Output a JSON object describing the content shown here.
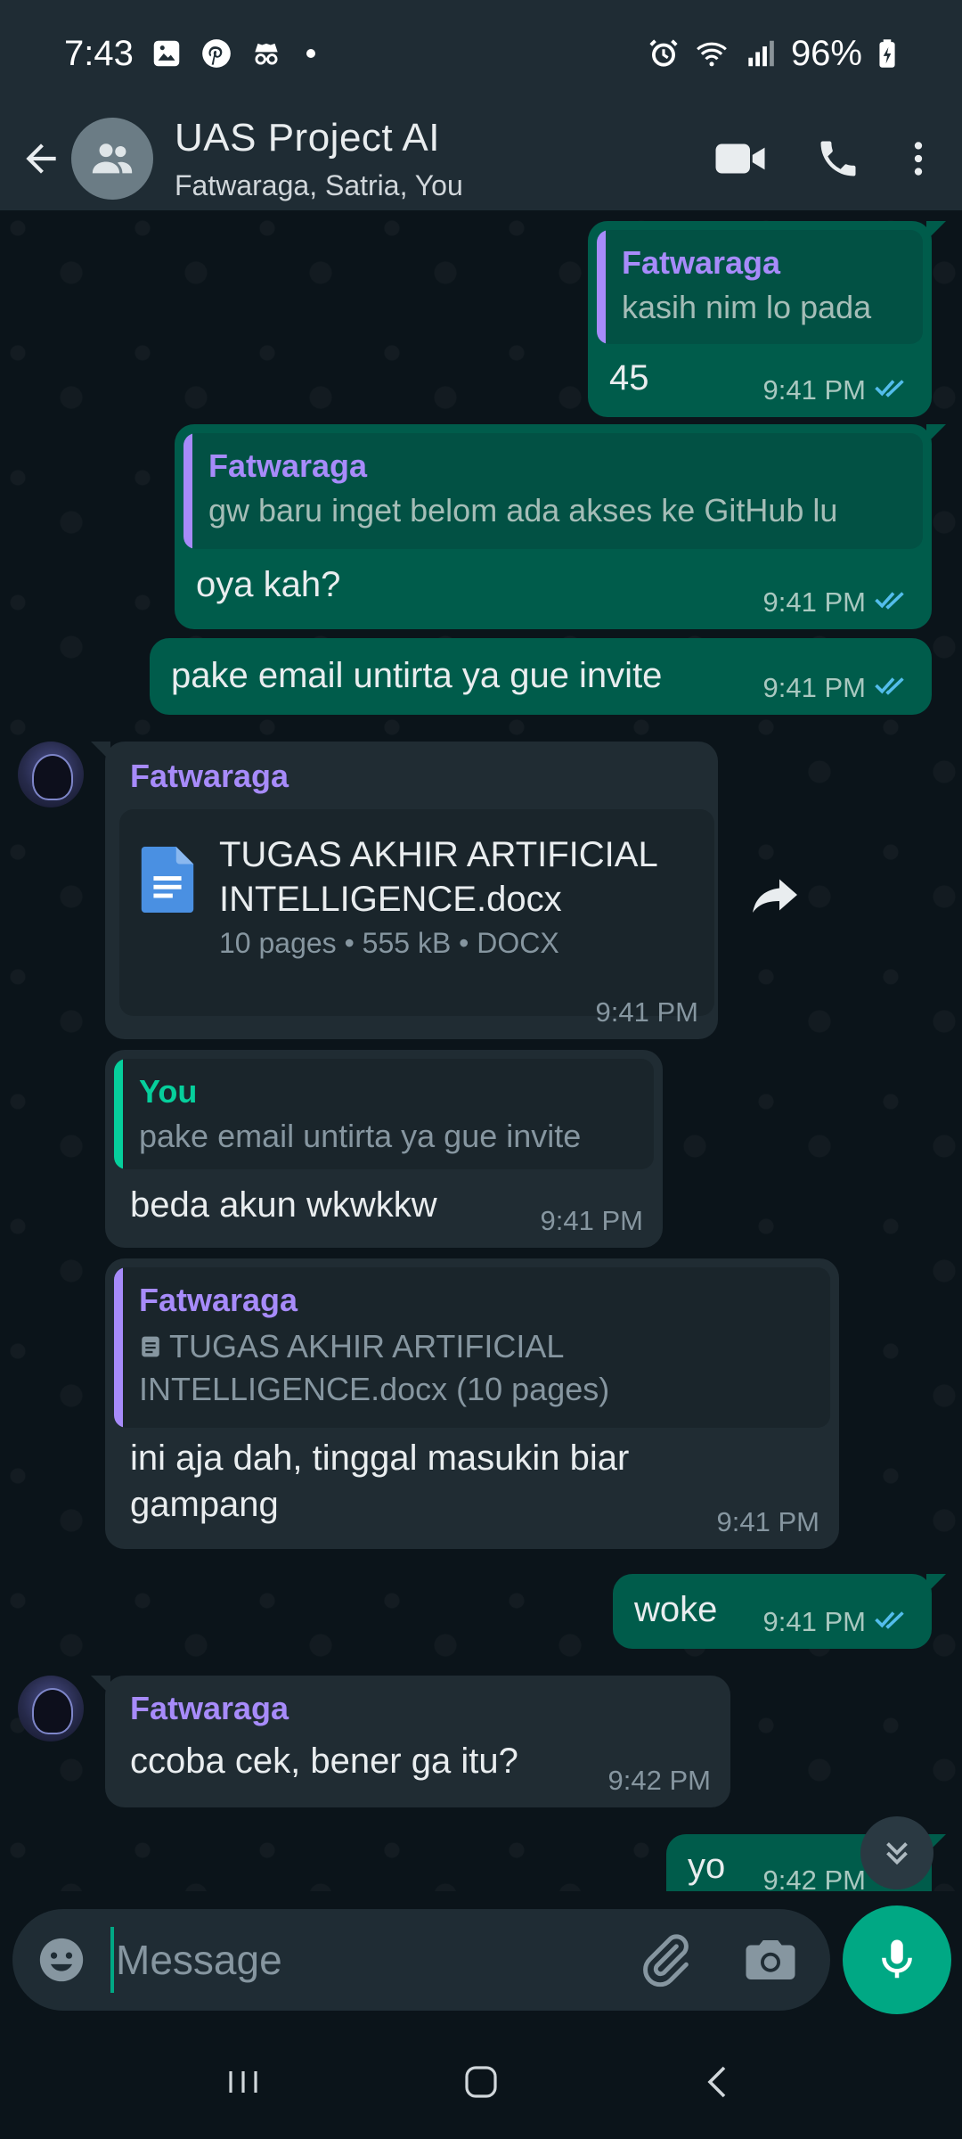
{
  "status_bar": {
    "time": "7:43",
    "battery": "96%",
    "icons": [
      "gallery-icon",
      "pinterest-icon",
      "incognito-icon",
      "alarm-icon",
      "wifi-icon",
      "signal-icon",
      "battery-charging-icon"
    ]
  },
  "header": {
    "title": "UAS Project AI",
    "subtitle": "Fatwaraga, Satria, You"
  },
  "colors": {
    "header_bg": "#1f2c34",
    "chat_bg": "#0b141a",
    "outgoing_bubble": "#005c4b",
    "incoming_bubble": "#202c33",
    "accent_green": "#00a884",
    "read_ticks": "#53bdeb",
    "sender_purple": "#a78bfa"
  },
  "messages": [
    {
      "direction": "out",
      "quote": {
        "name": "Fatwaraga",
        "text": "kasih nim lo pada"
      },
      "text": "45",
      "time": "9:41 PM",
      "status": "read"
    },
    {
      "direction": "out",
      "quote": {
        "name": "Fatwaraga",
        "text": "gw baru inget belom ada akses ke GitHub lu"
      },
      "text": "oya kah?",
      "time": "9:41 PM",
      "status": "read"
    },
    {
      "direction": "out",
      "text": "pake email untirta ya gue invite",
      "time": "9:41 PM",
      "status": "read"
    },
    {
      "direction": "in",
      "sender": "Fatwaraga",
      "document": {
        "name_line1": "TUGAS AKHIR ARTIFICIAL",
        "name_line2": "INTELLIGENCE.docx",
        "meta": "10 pages • 555 kB • DOCX"
      },
      "time": "9:41 PM"
    },
    {
      "direction": "in",
      "quote": {
        "name": "You",
        "text": "pake email untirta ya gue invite"
      },
      "text": "beda akun wkwkkw",
      "time": "9:41 PM"
    },
    {
      "direction": "in",
      "quote": {
        "name": "Fatwaraga",
        "line1": "TUGAS AKHIR ARTIFICIAL",
        "line2": "INTELLIGENCE.docx (10 pages)"
      },
      "text_line1": "ini aja dah, tinggal masukin biar",
      "text_line2": "gampang",
      "time": "9:41 PM"
    },
    {
      "direction": "out",
      "text": "woke",
      "time": "9:41 PM",
      "status": "read"
    },
    {
      "direction": "in",
      "sender": "Fatwaraga",
      "text": "ccoba cek, bener ga itu?",
      "time": "9:42 PM"
    },
    {
      "direction": "out",
      "text": "yo",
      "time": "9:42 PM",
      "status": "read"
    }
  ],
  "composer": {
    "placeholder": "Message"
  }
}
